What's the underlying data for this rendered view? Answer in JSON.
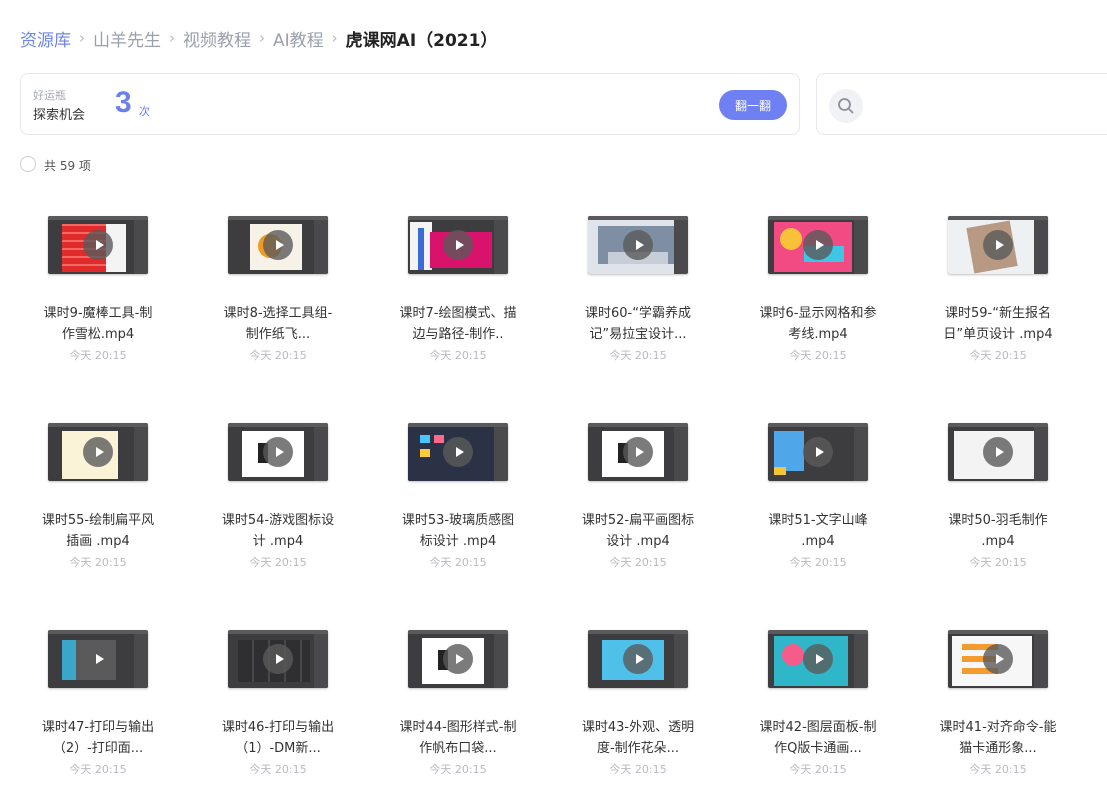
{
  "breadcrumb": {
    "items": [
      "资源库",
      "山羊先生",
      "视频教程",
      "AI教程",
      "虎课网AI（2021）"
    ],
    "separator": "›"
  },
  "lucky": {
    "small": "好运瓶",
    "label": "探索机会",
    "count": "3",
    "unit": "次",
    "button": "翻一翻"
  },
  "search": {
    "icon": "search-icon"
  },
  "summary": {
    "total": "共 59 项"
  },
  "files": [
    {
      "name": "课时9-魔棒工具-制作雪松.mp4",
      "time": "今天 20:15",
      "art": "red"
    },
    {
      "name": "课时8-选择工具组-制作纸飞...",
      "time": "今天 20:15",
      "art": "orange"
    },
    {
      "name": "课时7-绘图模式、描边与路径-制作..",
      "time": "今天 20:15",
      "art": "pink"
    },
    {
      "name": "课时60-“学霸养成记”易拉宝设计...",
      "time": "今天 20:15",
      "art": "room"
    },
    {
      "name": "课时6-显示网格和参考线.mp4",
      "time": "今天 20:15",
      "art": "colorful"
    },
    {
      "name": "课时59-“新生报名日”单页设计 .mp4",
      "time": "今天 20:15",
      "art": "paper"
    },
    {
      "name": "课时55-绘制扁平风插画 .mp4",
      "time": "今天 20:15",
      "art": "cream"
    },
    {
      "name": "课时54-游戏图标设计 .mp4",
      "time": "今天 20:15",
      "art": "white"
    },
    {
      "name": "课时53-玻璃质感图标设计 .mp4",
      "time": "今天 20:15",
      "art": "navy"
    },
    {
      "name": "课时52-扁平画图标设计 .mp4",
      "time": "今天 20:15",
      "art": "white"
    },
    {
      "name": "课时51-文字山峰 .mp4",
      "time": "今天 20:15",
      "art": "blue"
    },
    {
      "name": "课时50-羽毛制作 .mp4",
      "time": "今天 20:15",
      "art": "sketch"
    },
    {
      "name": "课时47-打印与输出（2）-打印面...",
      "time": "今天 20:15",
      "art": "cyan"
    },
    {
      "name": "课时46-打印与输出（1）-DM新...",
      "time": "今天 20:15",
      "art": "darkgrid"
    },
    {
      "name": "课时44-图形样式-制作帆布口袋...",
      "time": "今天 20:15",
      "art": "white"
    },
    {
      "name": "课时43-外观、透明度-制作花朵...",
      "time": "今天 20:15",
      "art": "sky"
    },
    {
      "name": "课时42-图层面板-制作Q版卡通画...",
      "time": "今天 20:15",
      "art": "teal"
    },
    {
      "name": "课时41-对齐命令-能猫卡通形象...",
      "time": "今天 20:15",
      "art": "stripes"
    }
  ]
}
